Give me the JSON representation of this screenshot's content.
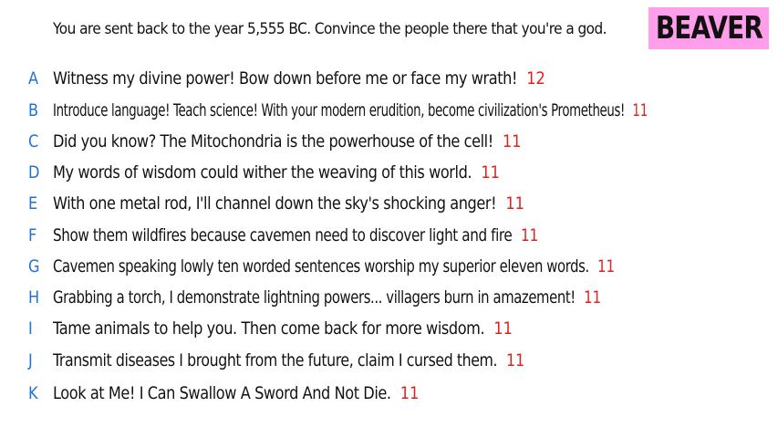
{
  "prompt": "You are sent back to the year 5,555 BC. Convince the people there that you're a god.",
  "player": "BEAVER",
  "colors": {
    "badge_bg": "#ff9eea",
    "letter": "#1e73d2",
    "score": "#e0201c",
    "text": "#111111"
  },
  "answers": [
    {
      "letter": "A",
      "text": "Witness my divine power! Bow down before me or face my wrath!",
      "score": "12"
    },
    {
      "letter": "B",
      "text": "Introduce language! Teach science! With your modern erudition, become civilization's Prometheus!",
      "score": "11"
    },
    {
      "letter": "C",
      "text": "Did you know? The Mitochondria is the powerhouse of the cell!",
      "score": "11"
    },
    {
      "letter": "D",
      "text": "My words of wisdom could wither the weaving of this world.",
      "score": "11"
    },
    {
      "letter": "E",
      "text": "With one metal rod, I'll channel down the sky's shocking anger!",
      "score": "11"
    },
    {
      "letter": "F",
      "text": "Show them wildfires because cavemen need to discover light and fire",
      "score": "11"
    },
    {
      "letter": "G",
      "text": "Cavemen speaking lowly ten worded sentences worship my superior eleven words.",
      "score": "11"
    },
    {
      "letter": "H",
      "text": "Grabbing a torch, I demonstrate lightning powers... villagers burn in amazement!",
      "score": "11"
    },
    {
      "letter": "I",
      "text": "Tame animals to help you. Then come back for more wisdom.",
      "score": "11"
    },
    {
      "letter": "J",
      "text": "Transmit diseases I brought from the future, claim I cursed them.",
      "score": "11"
    },
    {
      "letter": "K",
      "text": "Look at Me! I Can Swallow A Sword And Not Die.",
      "score": "11"
    }
  ]
}
